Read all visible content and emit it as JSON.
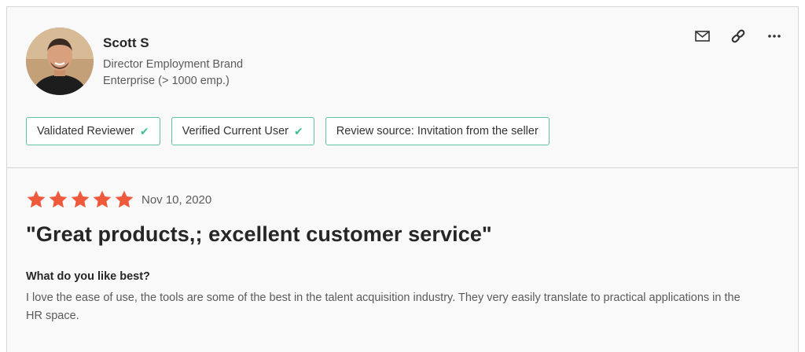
{
  "reviewer": {
    "name": "Scott S",
    "title": "Director Employment Brand",
    "company_size": "Enterprise (> 1000 emp.)"
  },
  "actions": [
    {
      "icon": "envelope-icon"
    },
    {
      "icon": "link-icon"
    },
    {
      "icon": "more-icon"
    }
  ],
  "badges": [
    {
      "label": "Validated Reviewer",
      "checked": true
    },
    {
      "label": "Verified Current User",
      "checked": true
    },
    {
      "label": "Review source: Invitation from the seller",
      "checked": false
    }
  ],
  "review": {
    "rating": 5,
    "max_rating": 5,
    "date": "Nov 10, 2020",
    "headline": "\"Great products,; excellent customer service\"",
    "question": "What do you like best?",
    "answer": "I love the ease of use, the tools are some of the best in the talent acquisition industry. They very easily translate to practical applications in the HR space."
  },
  "colors": {
    "badge_border": "#5fc3a0",
    "check": "#3fbf8f",
    "star": "#ef5a3c"
  }
}
